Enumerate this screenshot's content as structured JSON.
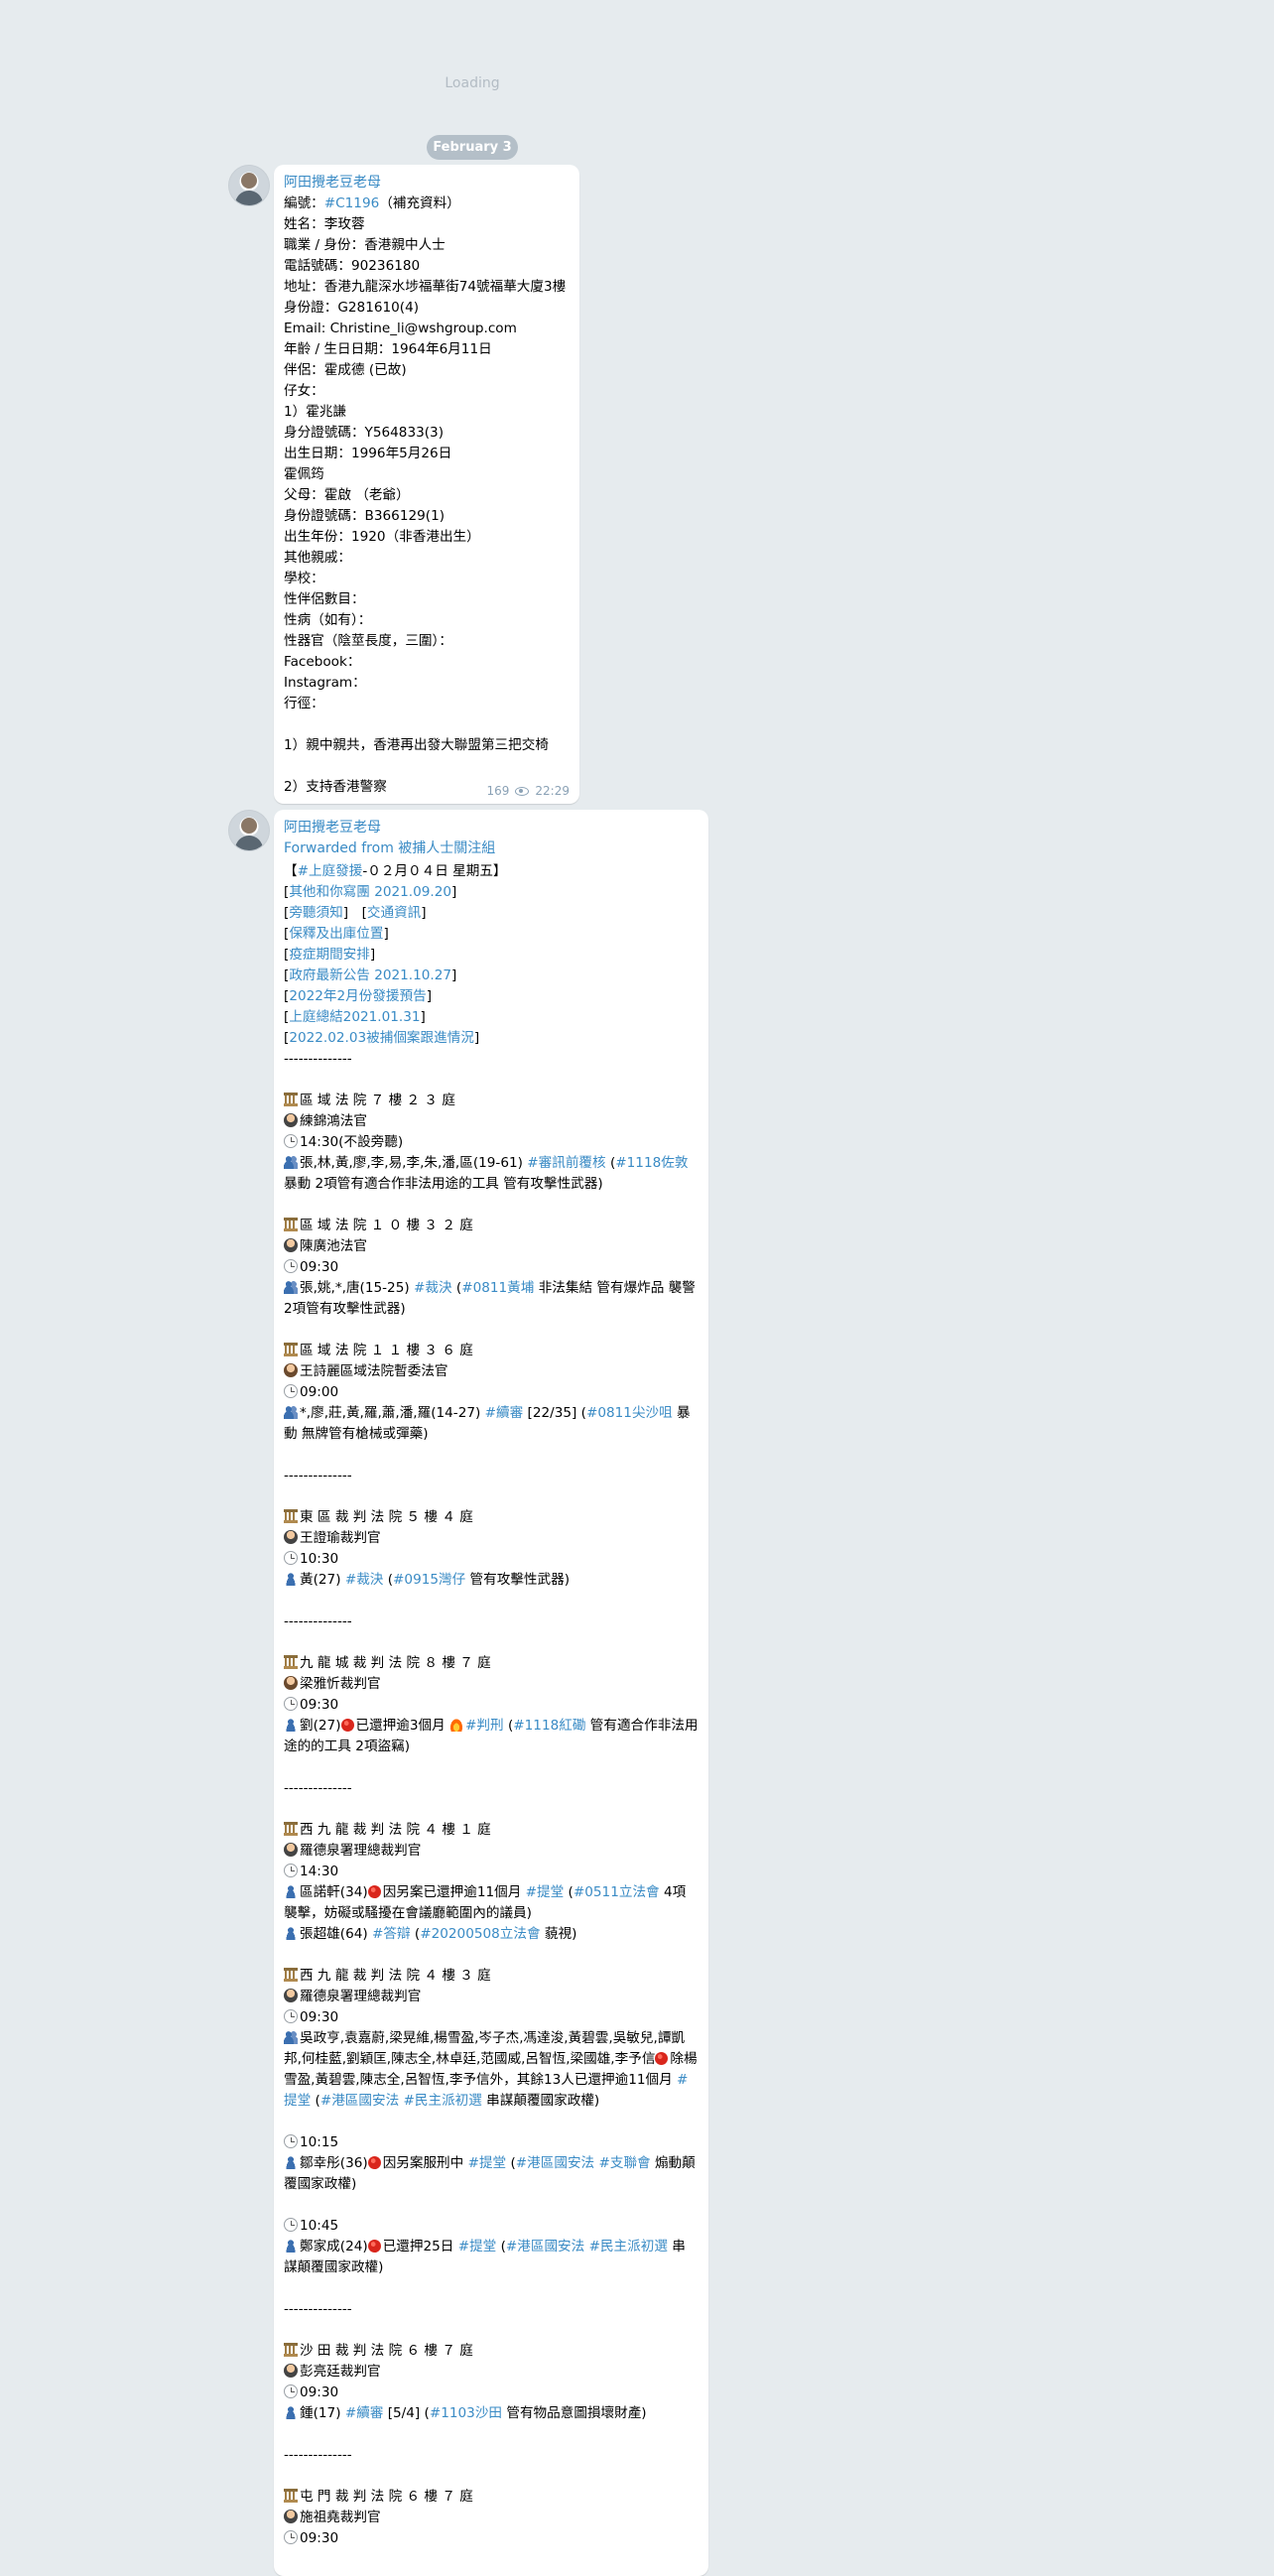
{
  "status": {
    "loading": "Loading"
  },
  "date_pill": "February 3",
  "msg1": {
    "sender": "阿田攪老豆老母",
    "lines": [
      [
        {
          "t": "編號："
        },
        {
          "t": "#C1196",
          "link": true
        },
        {
          "t": "（補充資料）"
        }
      ],
      [
        {
          "t": "姓名：李玫蓉"
        }
      ],
      [
        {
          "t": "職業 / 身份：香港親中人士"
        }
      ],
      [
        {
          "t": "電話號碼：90236180"
        }
      ],
      [
        {
          "t": "地址：香港九龍深水埗福華街74號福華大廈3樓"
        }
      ],
      [
        {
          "t": "身份證：G281610(4)"
        }
      ],
      [
        {
          "t": "Email: Christine_li@wshgroup.com"
        }
      ],
      [
        {
          "t": "年齡 / 生日日期：1964年6月11日"
        }
      ],
      [
        {
          "t": "伴侶：霍成德 (已故)"
        }
      ],
      [
        {
          "t": "仔女："
        }
      ],
      [
        {
          "t": "1）霍兆謙"
        }
      ],
      [
        {
          "t": "身分證號碼：Y564833(3)"
        }
      ],
      [
        {
          "t": "出生日期：1996年5月26日"
        }
      ],
      [
        {
          "t": "霍佩筠"
        }
      ],
      [
        {
          "t": "父母：霍啟 （老爺）"
        }
      ],
      [
        {
          "t": "身份證號碼：B366129(1)"
        }
      ],
      [
        {
          "t": "出生年份：1920（非香港出生）"
        }
      ],
      [
        {
          "t": "其他親戚："
        }
      ],
      [
        {
          "t": "學校："
        }
      ],
      [
        {
          "t": "性伴侶數目："
        }
      ],
      [
        {
          "t": "性病（如有）："
        }
      ],
      [
        {
          "t": "性器官（陰莖長度，三圍）："
        }
      ],
      [
        {
          "t": "Facebook："
        }
      ],
      [
        {
          "t": "Instagram："
        }
      ],
      [
        {
          "t": "行徑："
        }
      ],
      [],
      [
        {
          "t": "1）親中親共，香港再出發大聯盟第三把交椅"
        }
      ],
      [],
      [
        {
          "t": "2）支持香港警察"
        }
      ]
    ],
    "views": "169",
    "time": "22:29"
  },
  "msg2": {
    "sender": "阿田攪老豆老母",
    "forwarded_prefix": "Forwarded from ",
    "forwarded_source": "被捕人士關注組",
    "lines": [
      [
        {
          "t": "【"
        },
        {
          "t": "#上庭發援",
          "link": true
        },
        {
          "t": "‐０２月０４日 星期五】"
        }
      ],
      [
        {
          "t": " ["
        },
        {
          "t": "其他和你寫團 2021.09.20",
          "link": true
        },
        {
          "t": "]"
        }
      ],
      [
        {
          "t": " ["
        },
        {
          "t": "旁聽須知",
          "link": true
        },
        {
          "t": "]　["
        },
        {
          "t": "交通資訊",
          "link": true
        },
        {
          "t": "]"
        }
      ],
      [
        {
          "t": " ["
        },
        {
          "t": "保釋及出庫位置",
          "link": true
        },
        {
          "t": "]"
        }
      ],
      [
        {
          "t": " ["
        },
        {
          "t": "疫症期間安排",
          "link": true
        },
        {
          "t": "]"
        }
      ],
      [
        {
          "t": " ["
        },
        {
          "t": "政府最新公告 2021.10.27",
          "link": true
        },
        {
          "t": "]"
        }
      ],
      [
        {
          "t": " ["
        },
        {
          "t": "2022年2月份發援預告",
          "link": true
        },
        {
          "t": "]"
        }
      ],
      [
        {
          "t": " ["
        },
        {
          "t": "上庭總結2021.01.31",
          "link": true
        },
        {
          "t": "]"
        }
      ],
      [
        {
          "t": " ["
        },
        {
          "t": "2022.02.03被捕個案跟進情況",
          "link": true
        },
        {
          "t": "]"
        }
      ],
      [
        {
          "t": "‐‐‐‐‐‐‐‐‐‐‐‐‐‐"
        }
      ],
      [],
      [
        {
          "e": "court"
        },
        {
          "t": "區 域 法 院 ７ 樓 ２ ３ 庭"
        }
      ],
      [
        {
          "e": "judge"
        },
        {
          "t": "練錦鴻法官"
        }
      ],
      [
        {
          "e": "clock"
        },
        {
          "t": "14:30(不設旁聽)"
        }
      ],
      [
        {
          "e": "people"
        },
        {
          "t": "張,林,黃,廖,李,易,李,朱,潘,區(19-61) "
        },
        {
          "t": "#審訊前覆核",
          "link": true
        },
        {
          "t": " ("
        },
        {
          "t": "#1118佐敦",
          "link": true
        },
        {
          "t": " 暴動 2項管有適合作非法用途的工具 管有攻擊性武器)"
        }
      ],
      [],
      [
        {
          "e": "court"
        },
        {
          "t": "區 域 法 院 １ ０ 樓 ３ ２ 庭"
        }
      ],
      [
        {
          "e": "judge"
        },
        {
          "t": "陳廣池法官"
        }
      ],
      [
        {
          "e": "clock"
        },
        {
          "t": "09:30"
        }
      ],
      [
        {
          "e": "people"
        },
        {
          "t": "張,姚,*,唐(15-25) "
        },
        {
          "t": "#裁決",
          "link": true
        },
        {
          "t": " ("
        },
        {
          "t": "#0811黃埔",
          "link": true
        },
        {
          "t": " 非法集結 管有爆炸品 襲警 2項管有攻擊性武器)"
        }
      ],
      [],
      [
        {
          "e": "court"
        },
        {
          "t": "區 域 法 院 １ １ 樓 ３ ６ 庭"
        }
      ],
      [
        {
          "e": "judgef"
        },
        {
          "t": "王詩麗區域法院暫委法官"
        }
      ],
      [
        {
          "e": "clock"
        },
        {
          "t": "09:00"
        }
      ],
      [
        {
          "e": "people"
        },
        {
          "t": "*,廖,莊,黃,羅,蕭,潘,羅(14-27) "
        },
        {
          "t": "#續審",
          "link": true
        },
        {
          "t": " [22/35] ("
        },
        {
          "t": "#0811尖沙咀",
          "link": true
        },
        {
          "t": " 暴動 無牌管有槍械或彈藥)"
        }
      ],
      [],
      [
        {
          "t": "‐‐‐‐‐‐‐‐‐‐‐‐‐‐"
        }
      ],
      [],
      [
        {
          "e": "court"
        },
        {
          "t": "東 區 裁 判 法 院 ５ 樓 ４ 庭"
        }
      ],
      [
        {
          "e": "judge"
        },
        {
          "t": "王證瑜裁判官"
        }
      ],
      [
        {
          "e": "clock"
        },
        {
          "t": "10:30"
        }
      ],
      [
        {
          "e": "person"
        },
        {
          "t": "黃(27) "
        },
        {
          "t": "#裁決",
          "link": true
        },
        {
          "t": " ("
        },
        {
          "t": "#0915灣仔",
          "link": true
        },
        {
          "t": " 管有攻擊性武器)"
        }
      ],
      [],
      [
        {
          "t": "‐‐‐‐‐‐‐‐‐‐‐‐‐‐"
        }
      ],
      [],
      [
        {
          "e": "court"
        },
        {
          "t": "九 龍 城 裁 判 法 院 ８ 樓 ７ 庭"
        }
      ],
      [
        {
          "e": "judgef"
        },
        {
          "t": "梁雅忻裁判官"
        }
      ],
      [
        {
          "e": "clock"
        },
        {
          "t": "09:30"
        }
      ],
      [
        {
          "e": "person"
        },
        {
          "t": "劉(27)"
        },
        {
          "e": "red"
        },
        {
          "t": "已還押逾3個月 "
        },
        {
          "e": "fire"
        },
        {
          "t": "#判刑",
          "link": true
        },
        {
          "t": " ("
        },
        {
          "t": "#1118紅磡",
          "link": true
        },
        {
          "t": " 管有適合作非法用途的的工具 2項盜竊)"
        }
      ],
      [],
      [
        {
          "t": "‐‐‐‐‐‐‐‐‐‐‐‐‐‐"
        }
      ],
      [],
      [
        {
          "e": "court"
        },
        {
          "t": "西 九 龍 裁 判 法 院 ４ 樓 １ 庭"
        }
      ],
      [
        {
          "e": "judge"
        },
        {
          "t": "羅德泉署理總裁判官"
        }
      ],
      [
        {
          "e": "clock"
        },
        {
          "t": "14:30"
        }
      ],
      [
        {
          "e": "person"
        },
        {
          "t": "區諾軒(34)"
        },
        {
          "e": "red"
        },
        {
          "t": "因另案已還押逾11個月 "
        },
        {
          "t": "#提堂",
          "link": true
        },
        {
          "t": " ("
        },
        {
          "t": "#0511立法會",
          "link": true
        },
        {
          "t": " 4項襲擊，妨礙或騷擾在會議廳範圍內的議員)"
        }
      ],
      [
        {
          "e": "person"
        },
        {
          "t": "張超雄(64) "
        },
        {
          "t": "#答辯",
          "link": true
        },
        {
          "t": " ("
        },
        {
          "t": "#20200508立法會",
          "link": true
        },
        {
          "t": " 藐視)"
        }
      ],
      [],
      [
        {
          "e": "court"
        },
        {
          "t": "西 九 龍 裁 判 法 院 ４ 樓 ３ 庭"
        }
      ],
      [
        {
          "e": "judge"
        },
        {
          "t": "羅德泉署理總裁判官"
        }
      ],
      [
        {
          "e": "clock"
        },
        {
          "t": "09:30"
        }
      ],
      [
        {
          "e": "people"
        },
        {
          "t": "吳政亨,袁嘉蔚,梁晃維,楊雪盈,岑子杰,馮達浚,黃碧雲,吳敏兒,譚凱邦,何桂藍,劉穎匡,陳志全,林卓廷,范國威,呂智恆,梁國雄,李予信"
        },
        {
          "e": "red"
        },
        {
          "t": "除楊雪盈,黃碧雲,陳志全,呂智恆,李予信外，其餘13人已還押逾11個月 "
        },
        {
          "t": "#提堂",
          "link": true
        },
        {
          "t": " ("
        },
        {
          "t": "#港區國安法",
          "link": true
        },
        {
          "t": " "
        },
        {
          "t": "#民主派初選",
          "link": true
        },
        {
          "t": " 串謀顛覆國家政權)"
        }
      ],
      [],
      [
        {
          "e": "clock"
        },
        {
          "t": "10:15"
        }
      ],
      [
        {
          "e": "person"
        },
        {
          "t": "鄒幸彤(36)"
        },
        {
          "e": "red"
        },
        {
          "t": "因另案服刑中 "
        },
        {
          "t": "#提堂",
          "link": true
        },
        {
          "t": " ("
        },
        {
          "t": "#港區國安法",
          "link": true
        },
        {
          "t": " "
        },
        {
          "t": "#支聯會",
          "link": true
        },
        {
          "t": " 煽動顛覆國家政權)"
        }
      ],
      [],
      [
        {
          "e": "clock"
        },
        {
          "t": "10:45"
        }
      ],
      [
        {
          "e": "person"
        },
        {
          "t": "鄭家成(24)"
        },
        {
          "e": "red"
        },
        {
          "t": "已還押25日 "
        },
        {
          "t": "#提堂",
          "link": true
        },
        {
          "t": " ("
        },
        {
          "t": "#港區國安法",
          "link": true
        },
        {
          "t": " "
        },
        {
          "t": "#民主派初選",
          "link": true
        },
        {
          "t": " 串謀顛覆國家政權)"
        }
      ],
      [],
      [
        {
          "t": "‐‐‐‐‐‐‐‐‐‐‐‐‐‐"
        }
      ],
      [],
      [
        {
          "e": "court"
        },
        {
          "t": "沙 田 裁 判 法 院 ６ 樓 ７ 庭"
        }
      ],
      [
        {
          "e": "judge"
        },
        {
          "t": "彭亮廷裁判官"
        }
      ],
      [
        {
          "e": "clock"
        },
        {
          "t": "09:30"
        }
      ],
      [
        {
          "e": "person"
        },
        {
          "t": "鍾(17) "
        },
        {
          "t": "#續審",
          "link": true
        },
        {
          "t": " [5/4] ("
        },
        {
          "t": "#1103沙田",
          "link": true
        },
        {
          "t": " 管有物品意圖損壞財產)"
        }
      ],
      [],
      [
        {
          "t": "‐‐‐‐‐‐‐‐‐‐‐‐‐‐"
        }
      ],
      [],
      [
        {
          "e": "court"
        },
        {
          "t": "屯 門 裁 判 法 院 ６ 樓 ７ 庭"
        }
      ],
      [
        {
          "e": "judge"
        },
        {
          "t": "施祖堯裁判官"
        }
      ],
      [
        {
          "e": "clock"
        },
        {
          "t": "09:30"
        }
      ]
    ]
  },
  "icons": {
    "avatar": "user-avatar",
    "views": "eye-icon"
  }
}
